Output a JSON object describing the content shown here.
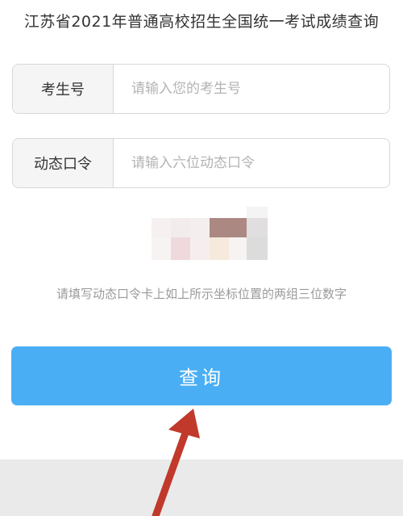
{
  "page": {
    "title": "江苏省2021年普通高校招生全国统一考试成绩查询"
  },
  "form": {
    "candidate": {
      "label": "考生号",
      "placeholder": "请输入您的考生号",
      "value": ""
    },
    "token": {
      "label": "动态口令",
      "placeholder": "请输入六位动态口令",
      "value": ""
    },
    "hint": "请填写动态口令卡上如上所示坐标位置的两组三位数字",
    "submit_label": "查询"
  },
  "colors": {
    "primary": "#4aaef5",
    "arrow": "#c0392b",
    "footer": "#eaeaea"
  },
  "annotation": {
    "arrow_icon": "red-arrow-icon"
  }
}
